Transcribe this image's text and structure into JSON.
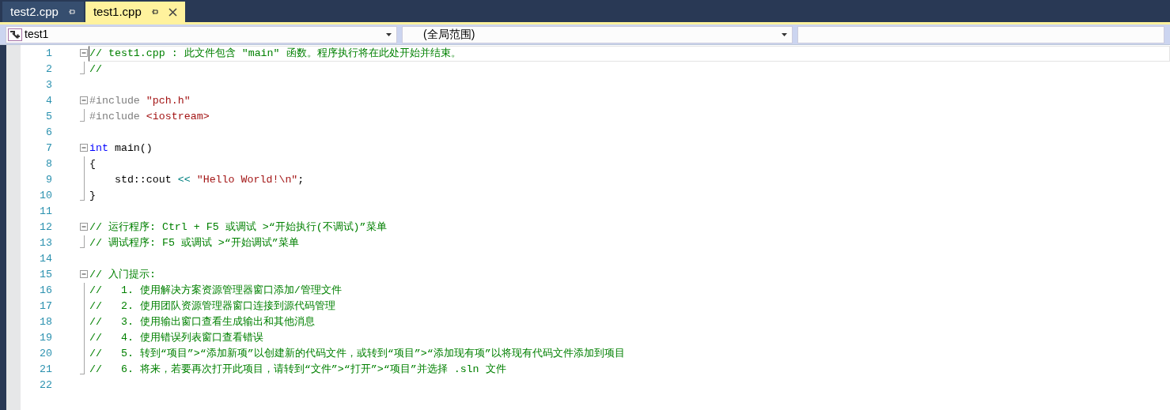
{
  "tabs": [
    {
      "label": "test2.cpp",
      "selected": false
    },
    {
      "label": "test1.cpp",
      "selected": true
    }
  ],
  "navigation_bar": [
    {
      "kind": "project",
      "text": "test1"
    },
    {
      "kind": "scope",
      "text": "(全局范围)"
    },
    {
      "kind": "member"
    }
  ],
  "lines": [
    {
      "number": "1",
      "kind": "start",
      "current": true,
      "tokens": [
        {
          "kind": "comment",
          "text": "// test1.cpp : 此文件包含 \"main\" 函数。程序执行将在此处开始并结束。"
        }
      ]
    },
    {
      "number": "2",
      "kind": "end",
      "current": false,
      "tokens": [
        {
          "kind": "comment",
          "text": "//"
        }
      ]
    },
    {
      "number": "3",
      "kind": "blank",
      "current": false
    },
    {
      "number": "4",
      "kind": "start",
      "current": false,
      "tokens": [
        {
          "kind": "preprocessor",
          "text": "#include "
        },
        {
          "kind": "string",
          "text": "\"pch.h\""
        }
      ]
    },
    {
      "number": "5",
      "kind": "end",
      "current": false,
      "tokens": [
        {
          "kind": "preprocessor",
          "text": "#include "
        },
        {
          "kind": "string",
          "text": "<iostream>"
        }
      ]
    },
    {
      "number": "6",
      "kind": "blank",
      "current": false
    },
    {
      "number": "7",
      "kind": "start",
      "current": false,
      "tokens": [
        {
          "kind": "keyword",
          "text": "int"
        },
        {
          "kind": "plain",
          "text": " main()"
        }
      ]
    },
    {
      "number": "8",
      "kind": "inner",
      "current": false,
      "tokens": [
        {
          "kind": "plain",
          "text": "{"
        }
      ]
    },
    {
      "number": "9",
      "kind": "inner",
      "current": false,
      "tokens": [
        {
          "kind": "plain",
          "text": "    std::cout "
        },
        {
          "kind": "operator",
          "text": "<< "
        },
        {
          "kind": "string",
          "text": "\"Hello World!\\n\""
        },
        {
          "kind": "plain",
          "text": ";"
        }
      ]
    },
    {
      "number": "10",
      "kind": "end",
      "current": false,
      "tokens": [
        {
          "kind": "plain",
          "text": "}"
        }
      ]
    },
    {
      "number": "11",
      "kind": "blank",
      "current": false
    },
    {
      "number": "12",
      "kind": "start",
      "current": false,
      "tokens": [
        {
          "kind": "comment",
          "text": "// 运行程序: Ctrl + F5 或调试 >“开始执行(不调试)”菜单"
        }
      ]
    },
    {
      "number": "13",
      "kind": "end",
      "current": false,
      "tokens": [
        {
          "kind": "comment",
          "text": "// 调试程序: F5 或调试 >“开始调试”菜单"
        }
      ]
    },
    {
      "number": "14",
      "kind": "blank",
      "current": false
    },
    {
      "number": "15",
      "kind": "start",
      "current": false,
      "tokens": [
        {
          "kind": "comment",
          "text": "// 入门提示:"
        }
      ]
    },
    {
      "number": "16",
      "kind": "inner",
      "current": false,
      "tokens": [
        {
          "kind": "comment",
          "text": "//   1. 使用解决方案资源管理器窗口添加/管理文件"
        }
      ]
    },
    {
      "number": "17",
      "kind": "inner",
      "current": false,
      "tokens": [
        {
          "kind": "comment",
          "text": "//   2. 使用团队资源管理器窗口连接到源代码管理"
        }
      ]
    },
    {
      "number": "18",
      "kind": "inner",
      "current": false,
      "tokens": [
        {
          "kind": "comment",
          "text": "//   3. 使用输出窗口查看生成输出和其他消息"
        }
      ]
    },
    {
      "number": "19",
      "kind": "inner",
      "current": false,
      "tokens": [
        {
          "kind": "comment",
          "text": "//   4. 使用错误列表窗口查看错误"
        }
      ]
    },
    {
      "number": "20",
      "kind": "inner",
      "current": false,
      "tokens": [
        {
          "kind": "comment",
          "text": "//   5. 转到“项目”>“添加新项”以创建新的代码文件，或转到“项目”>“添加现有项”以将现有代码文件添加到项目"
        }
      ]
    },
    {
      "number": "21",
      "kind": "end",
      "current": false,
      "tokens": [
        {
          "kind": "comment",
          "text": "//   6. 将来，若要再次打开此项目，请转到“文件”>“打开”>“项目”并选择 .sln 文件"
        }
      ]
    },
    {
      "number": "22",
      "kind": "blank",
      "current": false
    }
  ]
}
